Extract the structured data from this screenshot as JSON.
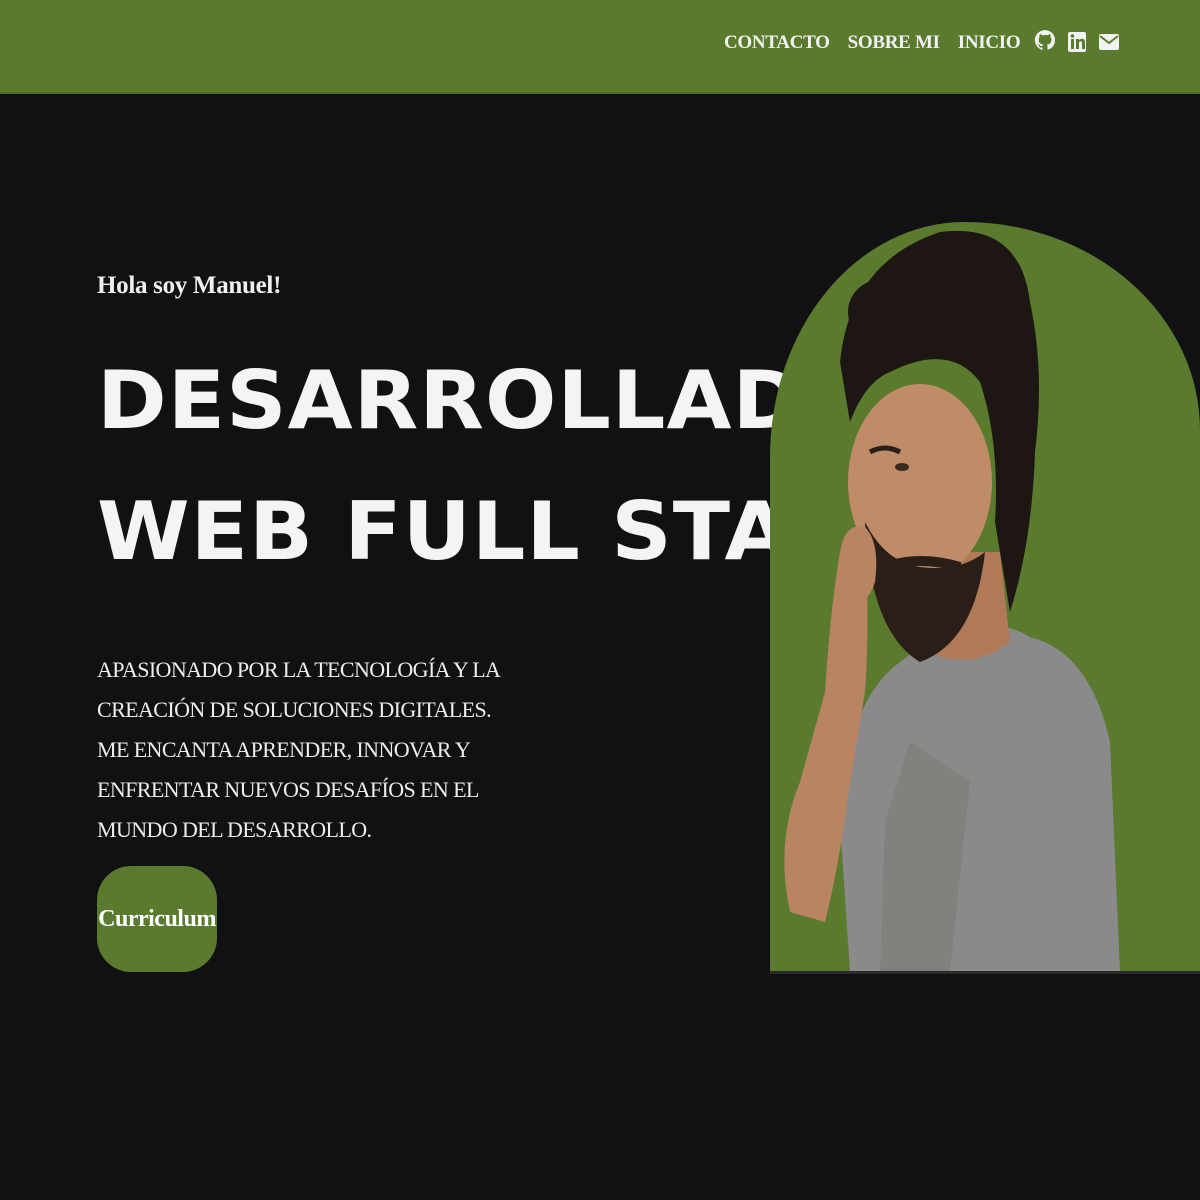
{
  "nav": {
    "items": [
      "CONTACTO",
      "SOBRE MI",
      "INICIO"
    ],
    "social": [
      "github-icon",
      "linkedin-icon",
      "mail-icon"
    ]
  },
  "hero": {
    "greeting": "Hola soy Manuel!",
    "headline_line1": "DESARROLLADOR",
    "headline_line2": "WEB FULL STACK",
    "description": "APASIONADO POR LA TECNOLOGÍA Y LA CREACIÓN DE SOLUCIONES DIGITALES. ME ENCANTA APRENDER, INNOVAR Y ENFRENTAR NUEVOS DESAFÍOS EN EL MUNDO DEL DESARROLLO.",
    "cv_button": "Curriculum"
  },
  "colors": {
    "accent": "#5a7a2e",
    "background": "#111114",
    "text": "#f4f4f4"
  }
}
